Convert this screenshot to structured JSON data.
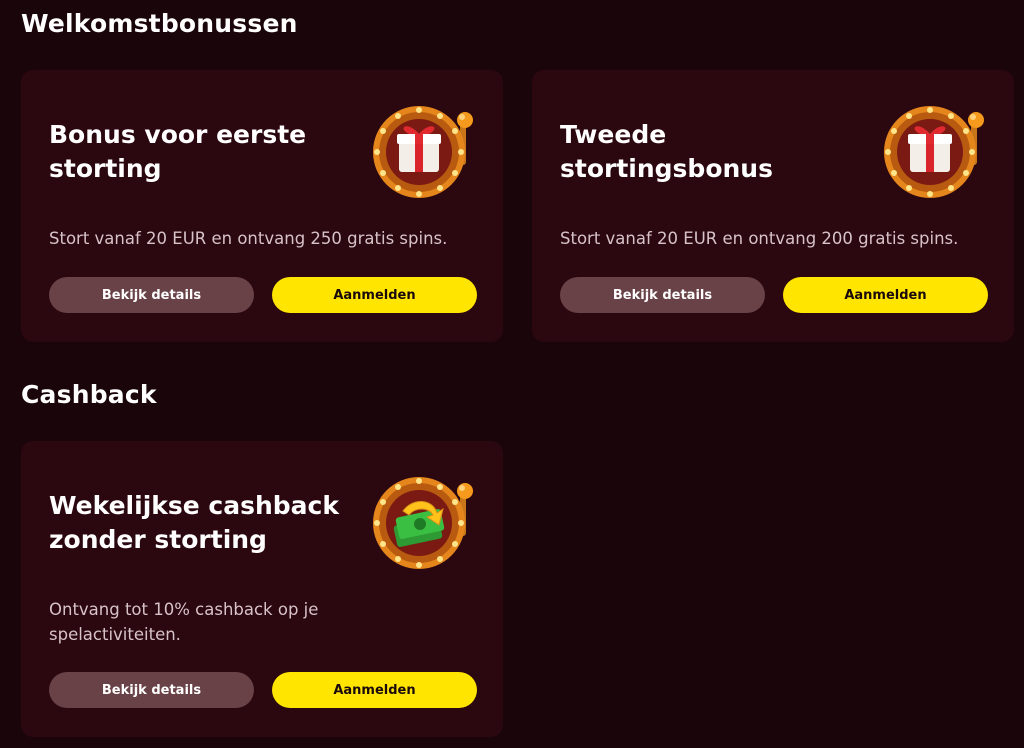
{
  "sections": {
    "welcome_title": "Welkomstbonussen",
    "cashback_title": "Cashback"
  },
  "cards": [
    {
      "title": "Bonus voor eerste storting",
      "description": "Stort vanaf 20 EUR en ontvang 250 gratis spins.",
      "details_label": "Bekijk details",
      "signup_label": "Aanmelden",
      "icon": "slot-machine-gift-icon"
    },
    {
      "title": "Tweede stortingsbonus",
      "description": "Stort vanaf 20 EUR en ontvang 200 gratis spins.",
      "details_label": "Bekijk details",
      "signup_label": "Aanmelden",
      "icon": "slot-machine-gift-icon"
    },
    {
      "title": "Wekelijkse cashback zonder storting",
      "description": "Ontvang tot 10% cashback op je spelactiviteiten.",
      "details_label": "Bekijk details",
      "signup_label": "Aanmelden",
      "icon": "slot-machine-cashback-icon"
    }
  ],
  "colors": {
    "background": "#1a050b",
    "card": "#2b0710",
    "primary_button": "#ffe500",
    "secondary_button": "#694247"
  }
}
